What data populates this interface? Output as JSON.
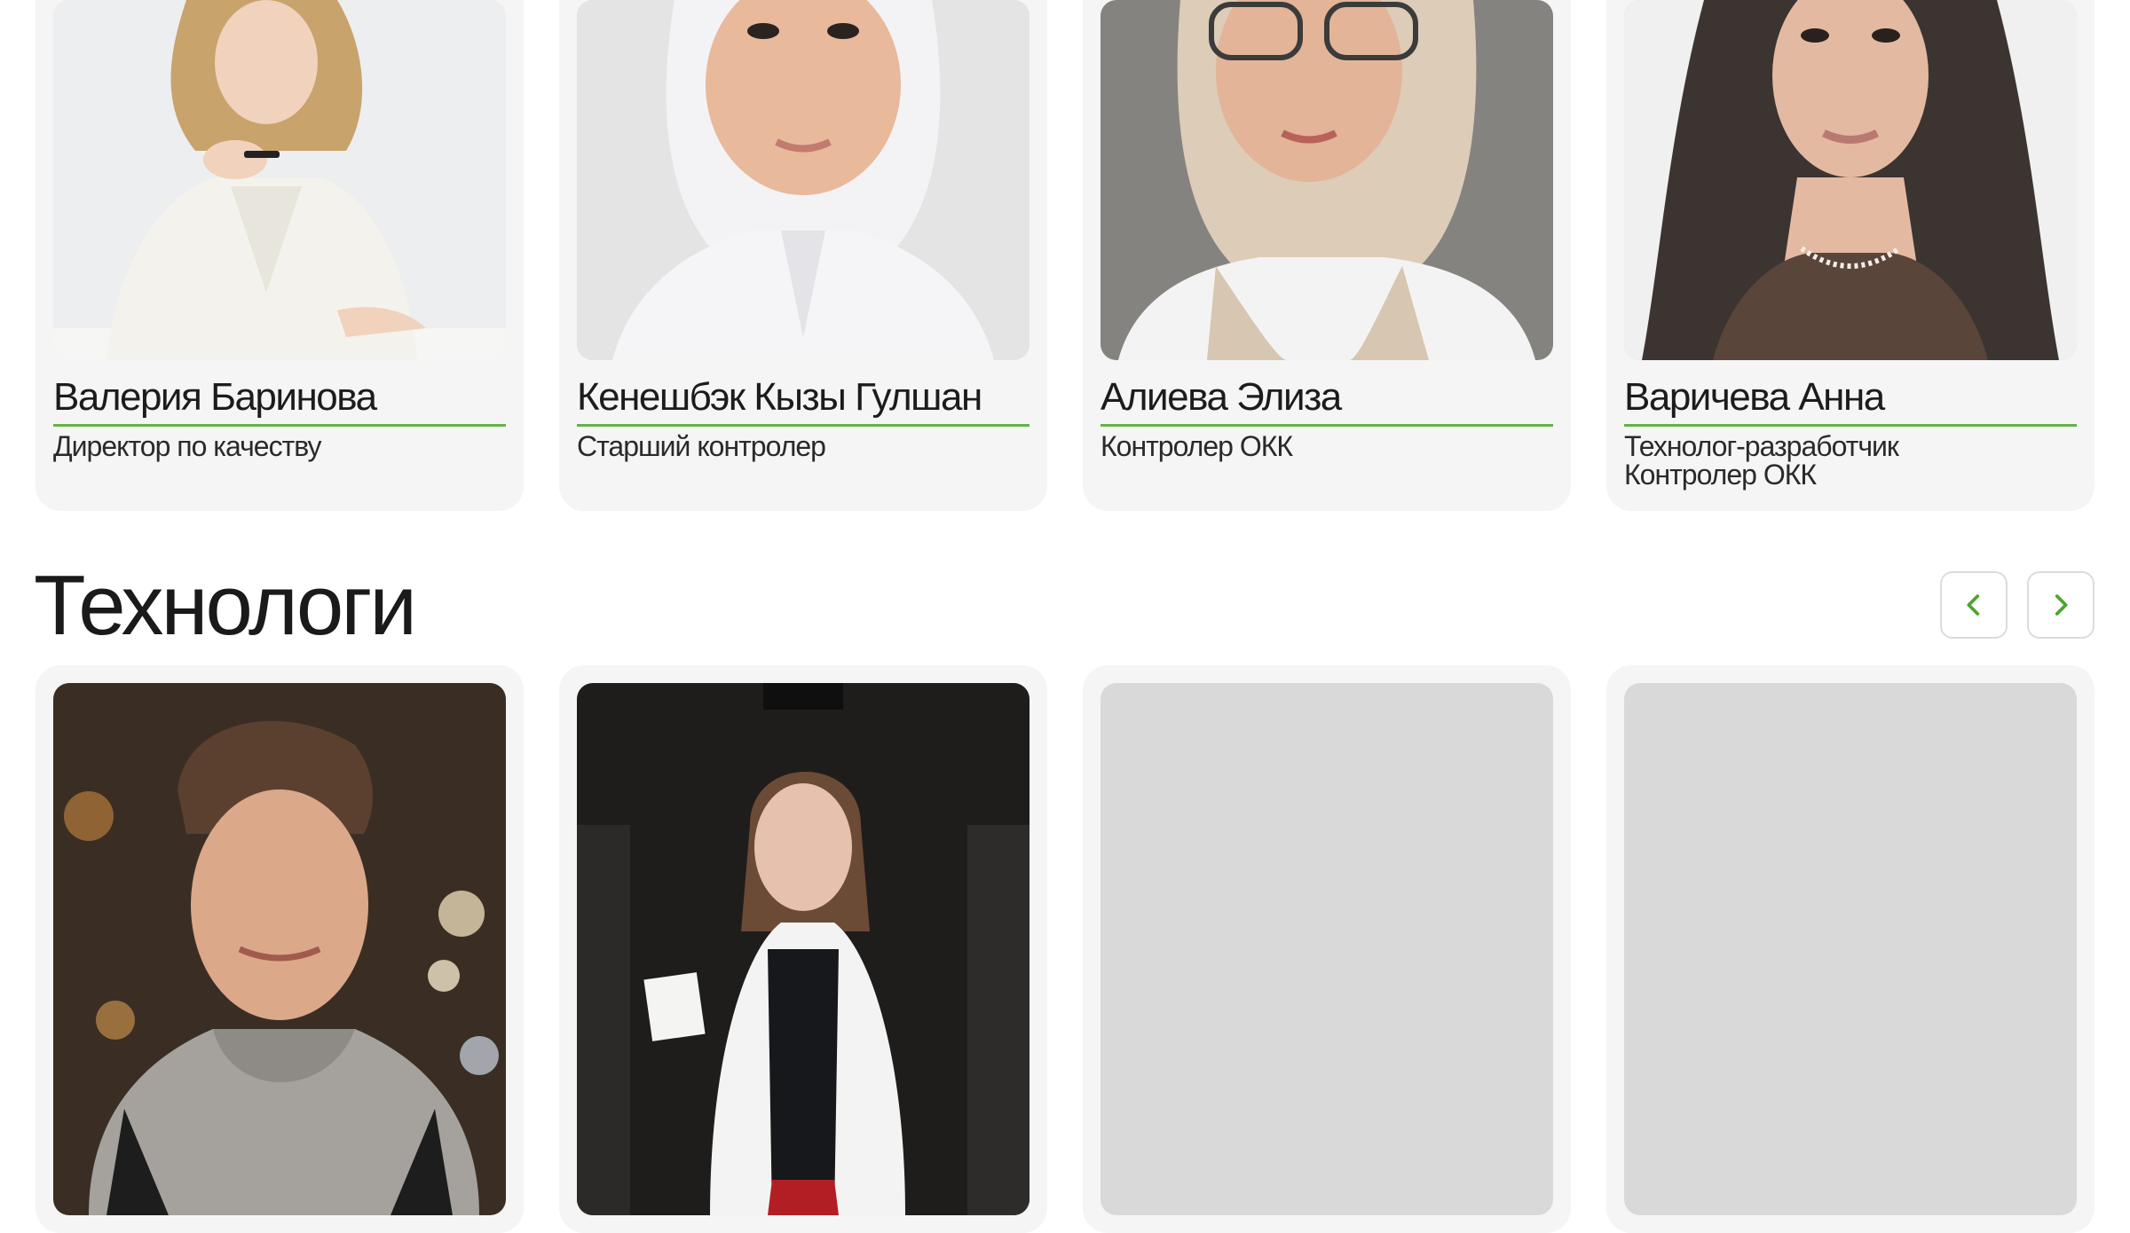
{
  "team_top": [
    {
      "name": "Валерия Баринова",
      "role_lines": [
        "Директор по качеству"
      ]
    },
    {
      "name": "Кенешбэк Кызы Гулшан",
      "role_lines": [
        "Старший контролер"
      ]
    },
    {
      "name": "Алиева Элиза",
      "role_lines": [
        "Контролер ОКК"
      ]
    },
    {
      "name": "Варичева Анна",
      "role_lines": [
        "Технолог-разработчик",
        "Контролер ОКК"
      ]
    }
  ],
  "section": {
    "title": "Технологи",
    "prev_icon": "chevron-left-icon",
    "next_icon": "chevron-right-icon"
  },
  "colors": {
    "accent": "#64b246",
    "card_bg": "#f5f5f5",
    "placeholder": "#d9d9d9"
  }
}
